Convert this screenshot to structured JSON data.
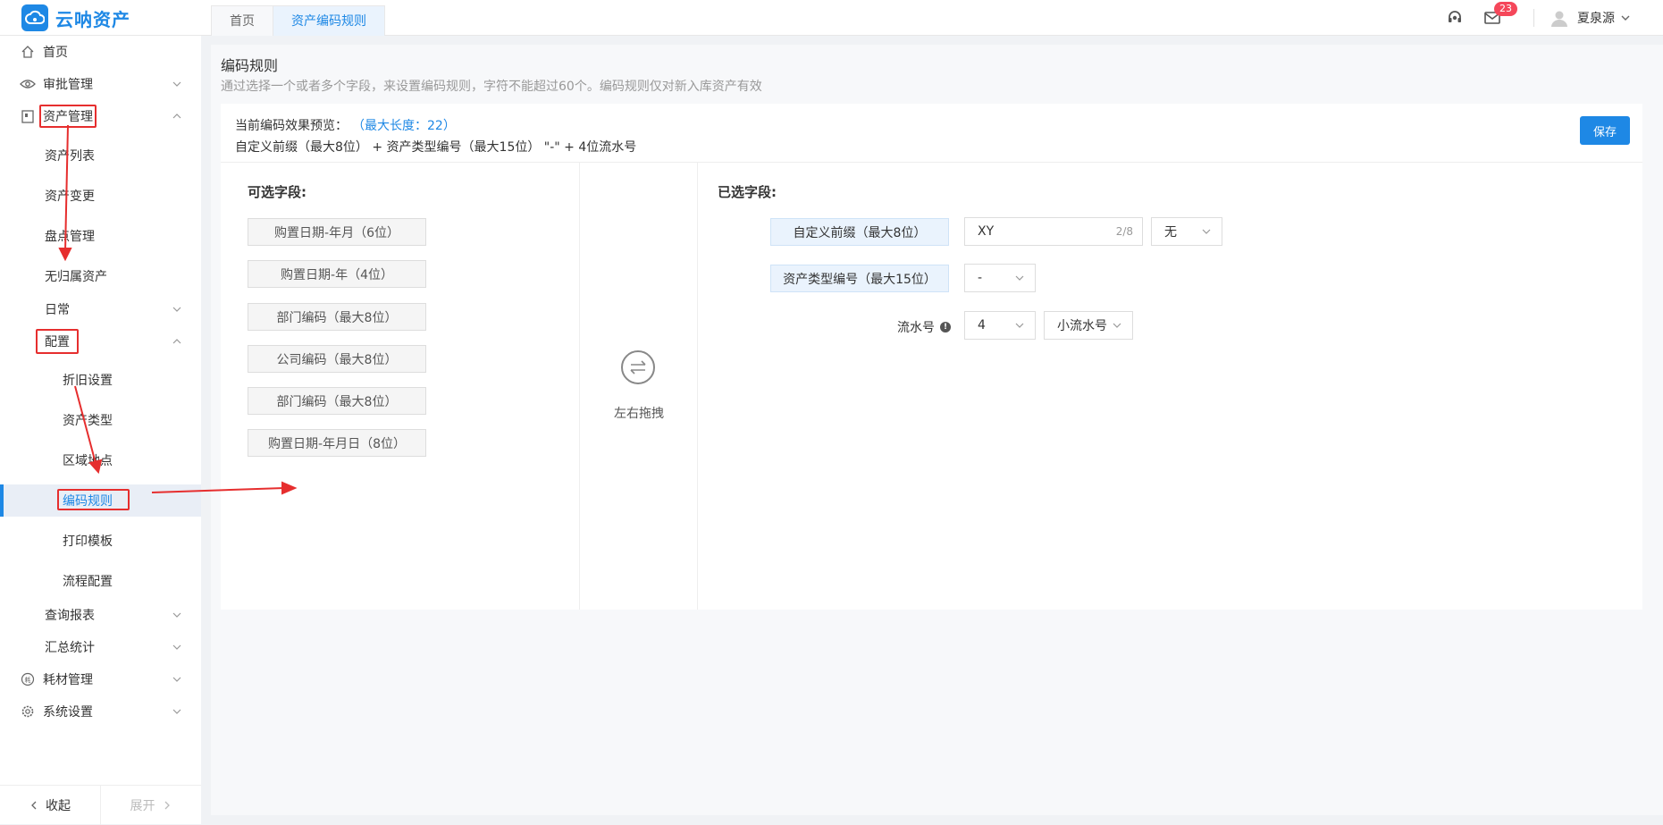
{
  "app": {
    "name": "云呐资产"
  },
  "tabs": [
    {
      "label": "首页"
    },
    {
      "label": "资产编码规则"
    }
  ],
  "header": {
    "message_count": "23",
    "user_name": "夏泉源"
  },
  "sidebar": {
    "items": [
      {
        "label": "首页"
      },
      {
        "label": "审批管理"
      },
      {
        "label": "资产管理"
      },
      {
        "label": "资产列表"
      },
      {
        "label": "资产变更"
      },
      {
        "label": "盘点管理"
      },
      {
        "label": "无归属资产"
      },
      {
        "label": "日常"
      },
      {
        "label": "配置"
      },
      {
        "label": "折旧设置"
      },
      {
        "label": "资产类型"
      },
      {
        "label": "区域地点"
      },
      {
        "label": "编码规则"
      },
      {
        "label": "打印模板"
      },
      {
        "label": "流程配置"
      },
      {
        "label": "查询报表"
      },
      {
        "label": "汇总统计"
      },
      {
        "label": "耗材管理"
      },
      {
        "label": "系统设置"
      }
    ],
    "collapse_label": "收起",
    "expand_label": "展开"
  },
  "page": {
    "title": "编码规则",
    "description": "通过选择一个或者多个字段，来设置编码规则，字符不能超过60个。编码规则仅对新入库资产有效",
    "preview_label": "当前编码效果预览：",
    "preview_maxlen": "（最大长度：22）",
    "preview_formula": "自定义前缀（最大8位） + 资产类型编号（最大15位） \"-\" + 4位流水号",
    "save_label": "保存"
  },
  "available": {
    "title": "可选字段:",
    "fields": [
      "购置日期-年月（6位）",
      "购置日期-年（4位）",
      "部门编码（最大8位）",
      "公司编码（最大8位）",
      "部门编码（最大8位）",
      "购置日期-年月日（8位）"
    ]
  },
  "middle": {
    "hint": "左右拖拽"
  },
  "selected": {
    "title": "已选字段:",
    "prefix_label": "自定义前缀（最大8位）",
    "prefix_value": "XY",
    "prefix_counter": "2/8",
    "prefix_separator": "无",
    "type_label": "资产类型编号（最大15位）",
    "type_separator": "-",
    "serial_label": "流水号",
    "serial_digits": "4",
    "serial_mode": "小流水号"
  },
  "colors": {
    "accent": "#1e88e5",
    "annotation": "#e62e2e",
    "badge": "#f5475a"
  }
}
